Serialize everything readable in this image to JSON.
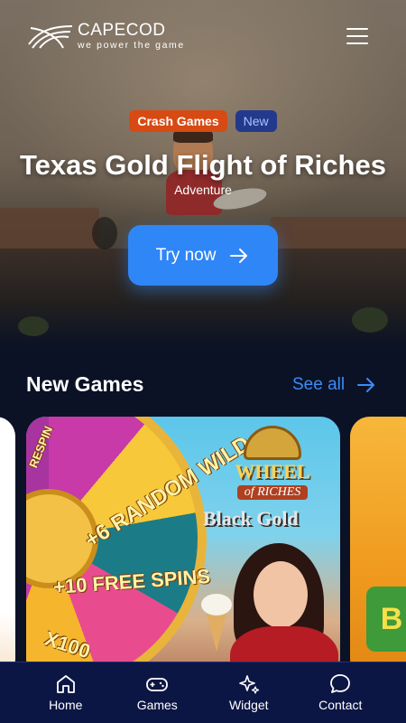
{
  "brand": {
    "name": "CAPECOD",
    "tagline": "we power the game"
  },
  "hero": {
    "category_tag": "Crash Games",
    "status_tag": "New",
    "title": "Texas Gold Flight of Riches",
    "genre": "Adventure",
    "cta_label": "Try now"
  },
  "new_games": {
    "title": "New Games",
    "see_all_label": "See all",
    "featured_card": {
      "logo_title_line1": "WHEEL",
      "logo_title_line2": "of RICHES",
      "subtitle": "Black Gold",
      "wheel_segments": [
        "+6 RANDOM WILD",
        "+10 FREE SPINS",
        "X100",
        "RESPIN"
      ]
    },
    "right_card_letter": "B"
  },
  "bottom_nav": {
    "items": [
      {
        "label": "Home",
        "icon": "home-icon"
      },
      {
        "label": "Games",
        "icon": "gamepad-icon"
      },
      {
        "label": "Widget",
        "icon": "sparkles-icon"
      },
      {
        "label": "Contact",
        "icon": "chat-bubble-icon"
      }
    ]
  },
  "colors": {
    "background": "#0b1226",
    "accent": "#2f86f6",
    "tag_category": "#d84a13",
    "tag_new": "#233a8c",
    "nav_background": "#0c1644"
  }
}
